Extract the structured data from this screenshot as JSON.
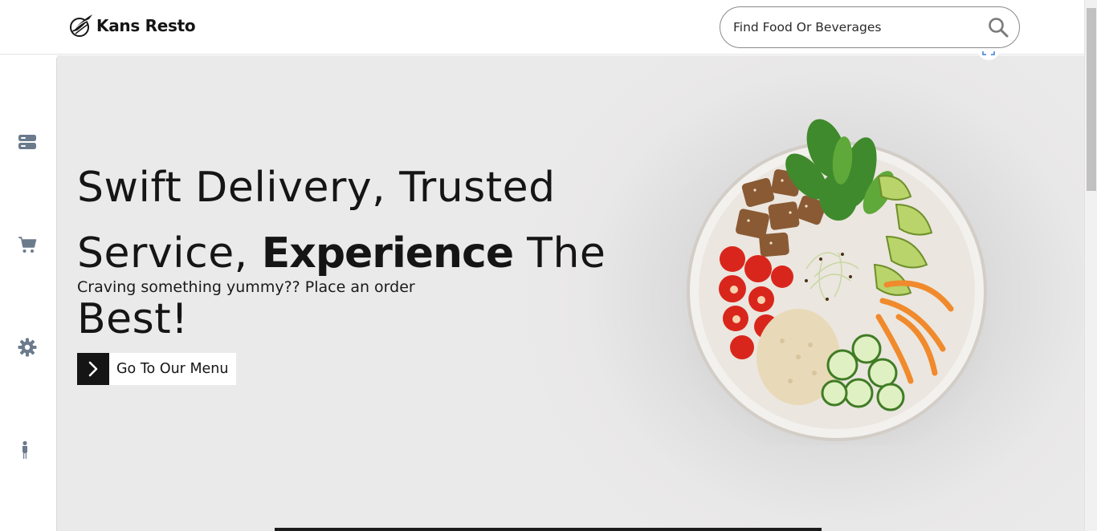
{
  "brand": {
    "name": "Kans Resto"
  },
  "search": {
    "placeholder": "Find Food Or Beverages"
  },
  "sidebar": {
    "items": [
      {
        "icon": "server-icon"
      },
      {
        "icon": "cart-icon"
      },
      {
        "icon": "gear-icon"
      },
      {
        "icon": "person-icon"
      }
    ]
  },
  "hero": {
    "title_line1": "Swift Delivery, Trusted",
    "title_line2_part1": "Service, ",
    "title_line2_strong": "Experience",
    "title_line2_part2": " The Best!",
    "subtitle": "Craving something yummy?? Place an order",
    "cta_label": "Go To Our Menu"
  },
  "colors": {
    "accent": "#151515",
    "hero_bg": "#ebeaea",
    "sidebar_icon": "#6b7b8c"
  }
}
